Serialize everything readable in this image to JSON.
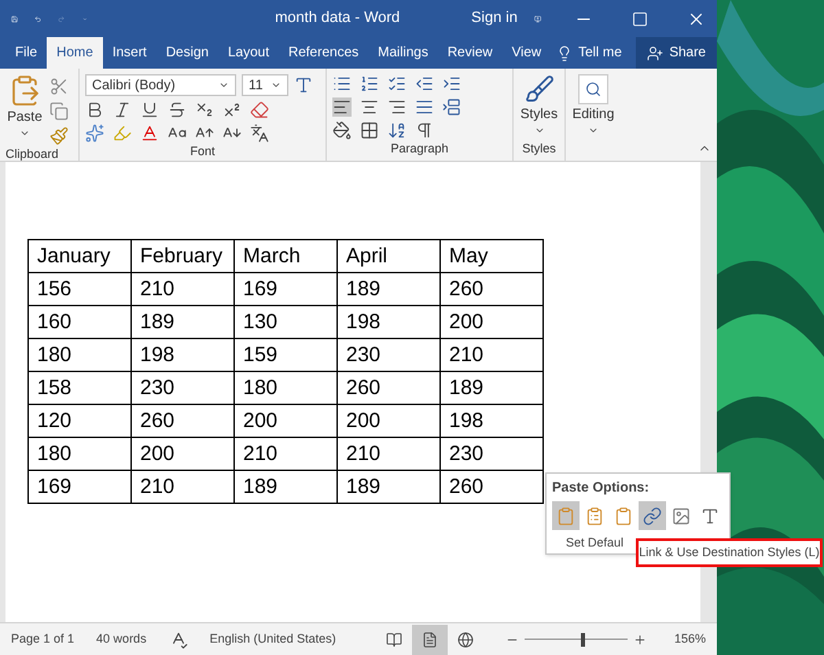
{
  "window": {
    "title": "month data - Word",
    "sign_in": "Sign in"
  },
  "tabs": [
    {
      "label": "File",
      "selected": false
    },
    {
      "label": "Home",
      "selected": true
    },
    {
      "label": "Insert",
      "selected": false
    },
    {
      "label": "Design",
      "selected": false
    },
    {
      "label": "Layout",
      "selected": false
    },
    {
      "label": "References",
      "selected": false
    },
    {
      "label": "Mailings",
      "selected": false
    },
    {
      "label": "Review",
      "selected": false
    },
    {
      "label": "View",
      "selected": false
    }
  ],
  "tell_me": "Tell me",
  "share": "Share",
  "ribbon": {
    "paste": "Paste",
    "font_name": "Calibri (Body)",
    "font_size": "11",
    "styles": "Styles",
    "editing": "Editing",
    "groups": [
      "Clipboard",
      "Font",
      "Paragraph",
      "Styles"
    ]
  },
  "table": {
    "rows": [
      [
        "January",
        "February",
        "March",
        "April",
        "May"
      ],
      [
        "156",
        "210",
        "169",
        "189",
        "260"
      ],
      [
        "160",
        "189",
        "130",
        "198",
        "200"
      ],
      [
        "180",
        "198",
        "159",
        "230",
        "210"
      ],
      [
        "158",
        "230",
        "180",
        "260",
        "189"
      ],
      [
        "120",
        "260",
        "200",
        "200",
        "198"
      ],
      [
        "180",
        "200",
        "210",
        "210",
        "230"
      ],
      [
        "169",
        "210",
        "189",
        "189",
        "260"
      ]
    ]
  },
  "paste_options": {
    "title": "Paste Options:",
    "footer": "Set Defaul",
    "options": [
      {
        "highlighted": true
      },
      {
        "highlighted": false
      },
      {
        "highlighted": false
      },
      {
        "highlighted": true
      },
      {
        "highlighted": false
      },
      {
        "highlighted": false
      }
    ]
  },
  "tooltip": "Link & Use Destination Styles (L)",
  "status_bar": {
    "page": "Page 1 of 1",
    "words": "40 words",
    "language": "English (United States)",
    "views": [
      {
        "selected": false
      },
      {
        "selected": true
      },
      {
        "selected": false
      }
    ],
    "zoom_slider": {
      "level": 0.55
    },
    "zoom": "156%"
  }
}
